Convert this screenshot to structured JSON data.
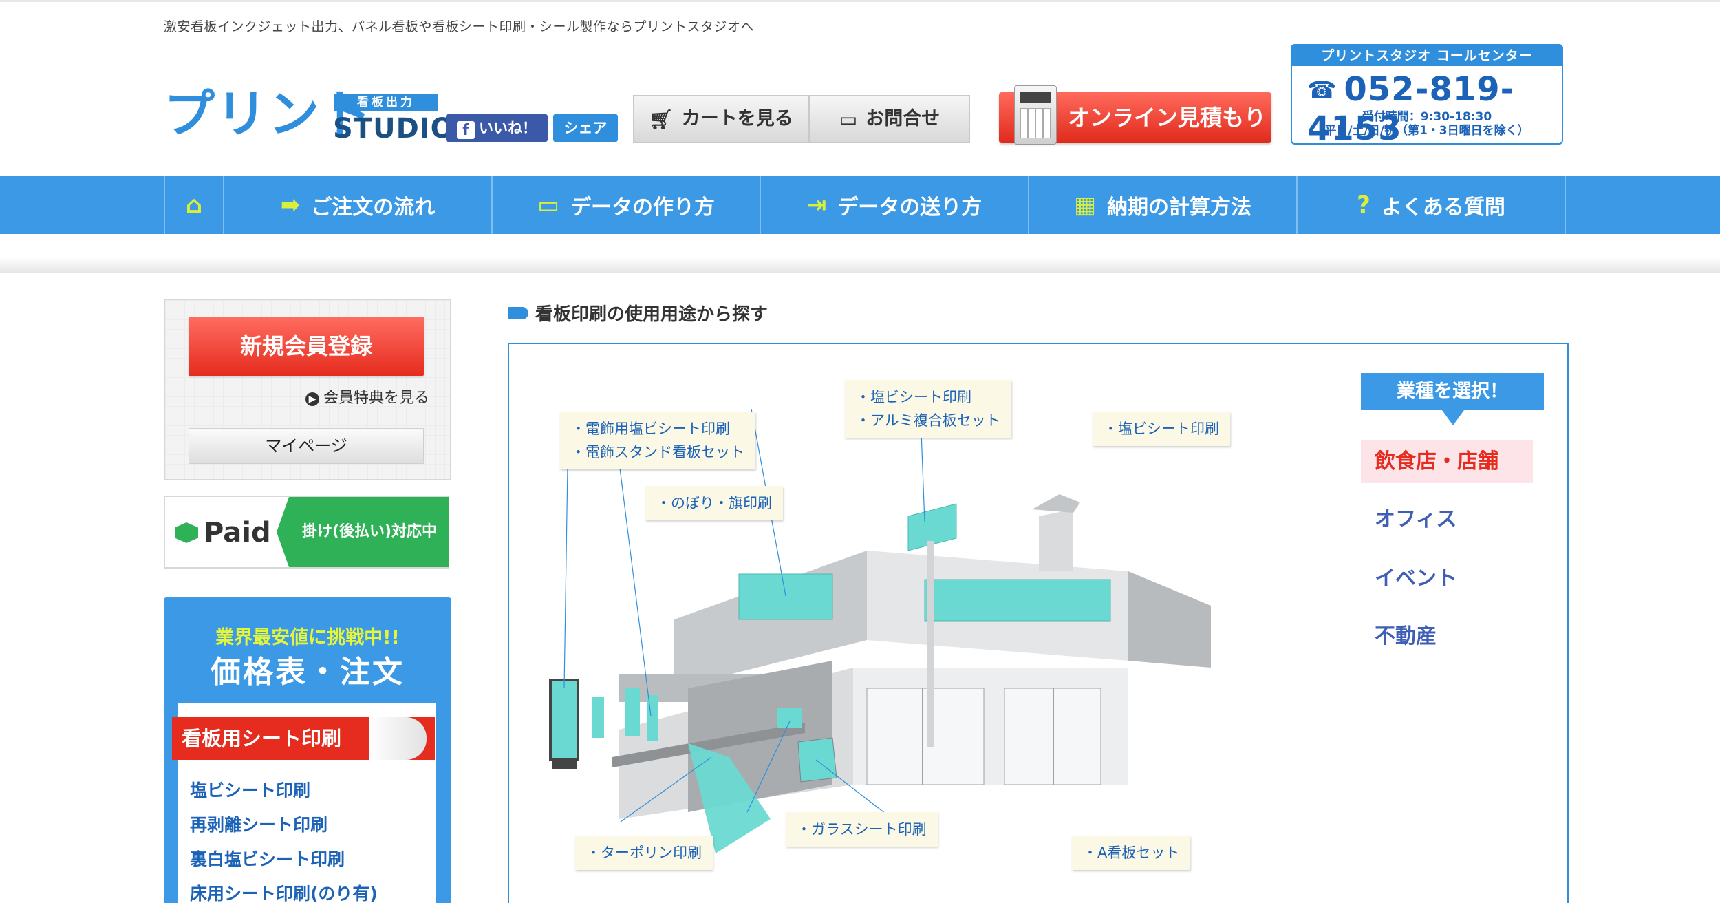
{
  "tagline": "激安看板インクジェット出力、パネル看板や看板シート印刷・シール製作ならプリントスタジオへ",
  "logo": {
    "kana": "プリント",
    "tag": "看板出力",
    "studio": "STUDIO"
  },
  "social": {
    "like": "いいね！",
    "share": "シェア"
  },
  "header": {
    "cart": "カートを見る",
    "contact": "お問合せ",
    "estimate": "オンライン見積もり"
  },
  "callcenter": {
    "title": "プリントスタジオ コールセンター",
    "phone": "052-819-4153",
    "hours": "受付時間：9:30-18:30",
    "closed": "平日/土/日/祝（第1・3日曜日を除く）"
  },
  "nav": [
    {
      "label": "",
      "icon": "home-icon",
      "glyph": "⌂"
    },
    {
      "label": "ご注文の流れ",
      "icon": "arrow-right-icon",
      "glyph": "➡"
    },
    {
      "label": "データの作り方",
      "icon": "monitor-icon",
      "glyph": "▭"
    },
    {
      "label": "データの送り方",
      "icon": "export-icon",
      "glyph": "⇥"
    },
    {
      "label": "納期の計算方法",
      "icon": "calendar-icon",
      "glyph": "▦"
    },
    {
      "label": "よくある質問",
      "icon": "question-icon",
      "glyph": "?"
    }
  ],
  "sidebar": {
    "register": "新規会員登録",
    "benefit": "会員特典を見る",
    "mypage": "マイページ",
    "paid_logo": "Paid",
    "paid_text": "掛け(後払い)対応中",
    "price_sub": "業界最安値に挑戦中!!",
    "price_title": "価格表・注文",
    "ribbon": "看板用シート印刷",
    "products": [
      "塩ビシート印刷",
      "再剥離シート印刷",
      "裏白塩ビシート印刷",
      "床用シート印刷(のり有)"
    ]
  },
  "main": {
    "section_title": "看板印刷の使用用途から探す",
    "callouts": {
      "c1_line1": "・電飾用塩ビシート印刷",
      "c1_line2": "・電飾スタンド看板セット",
      "c2_line1": "・塩ビシート印刷",
      "c2_line2": "・アルミ複合板セット",
      "c3": "・塩ビシート印刷",
      "c4": "・のぼり・旗印刷",
      "c5": "・ターポリン印刷",
      "c6": "・ガラスシート印刷",
      "c7": "・A看板セット"
    },
    "industry_title": "業種を選択！",
    "industries": [
      {
        "label": "飲食店・店舗",
        "active": true
      },
      {
        "label": "オフィス",
        "active": false
      },
      {
        "label": "イベント",
        "active": false
      },
      {
        "label": "不動産",
        "active": false
      }
    ]
  },
  "colors": {
    "brand_blue": "#3b99e6",
    "accent_red": "#e52c1e",
    "sign_cyan": "#6ad9d2",
    "paid_green": "#2fb157"
  }
}
